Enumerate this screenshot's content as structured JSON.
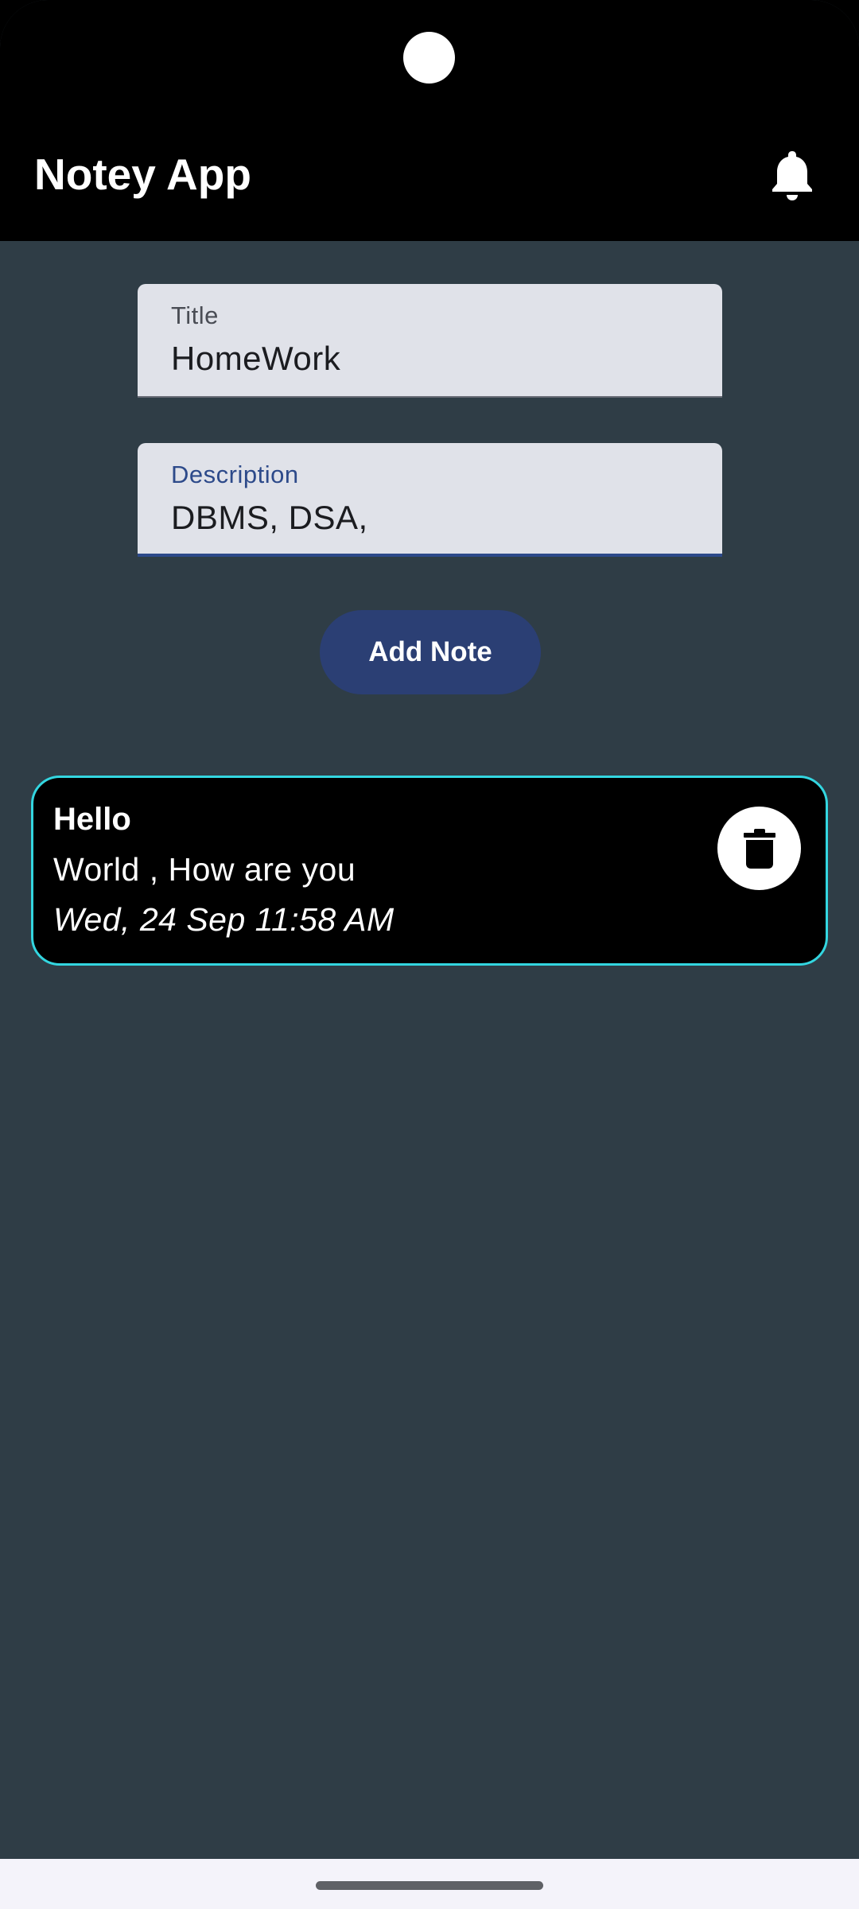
{
  "app": {
    "title": "Notey App"
  },
  "form": {
    "title_label": "Title",
    "title_value": "HomeWork",
    "description_label": "Description",
    "description_value": "DBMS, DSA,",
    "add_button_label": "Add Note"
  },
  "notes": [
    {
      "title": "Hello",
      "description": "World , How are you",
      "date": "Wed, 24 Sep 11:58 AM"
    }
  ],
  "icons": {
    "notification": "bell-icon",
    "delete": "trash-icon"
  },
  "colors": {
    "background": "#2f3d46",
    "topbar": "#000000",
    "button": "#2b3f74",
    "card_border": "#33d6e0",
    "field_bg": "#e0e2e9"
  }
}
